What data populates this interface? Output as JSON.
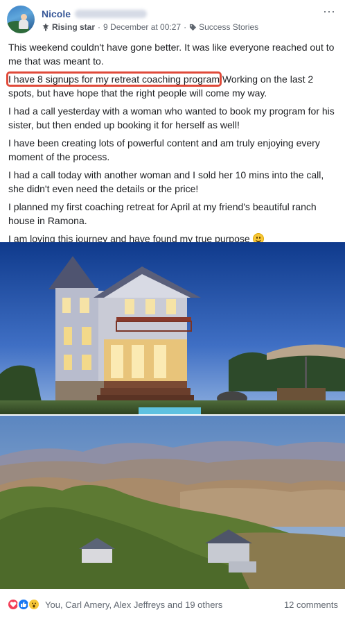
{
  "post": {
    "author_name": "Nicole",
    "badge": "Rising star",
    "timestamp": "9 December at 00:27",
    "topic": "Success Stories",
    "paragraphs": [
      "This weekend couldn't have gone better. It was like everyone reached out to me that was meant to.",
      "I had a call yesterday with a woman who wanted to book my program for his sister, but then ended up booking it for herself as well!",
      "I have been creating lots of powerful content and am truly enjoying every moment of the process.",
      "I had a call today with another woman and I sold her 10 mins into the call, she didn't even need the details or the price!",
      "I planned my first coaching retreat for April at my friend's beautiful ranch house in Ramona.",
      "I am loving this journey and have found my true purpose"
    ],
    "highlighted_text": "I have 8 signups for my retreat coaching program",
    "highlighted_rest": " Working on the last 2 spots, but have hope that the right people will come my way."
  },
  "reactions": {
    "icons": [
      "love-icon",
      "like-icon",
      "wow-icon"
    ],
    "names": "You, Carl Amery, Alex Jeffreys and 19 others",
    "comments": "12 comments"
  },
  "colors": {
    "name": "#385898",
    "highlight": "#e04a3a"
  }
}
